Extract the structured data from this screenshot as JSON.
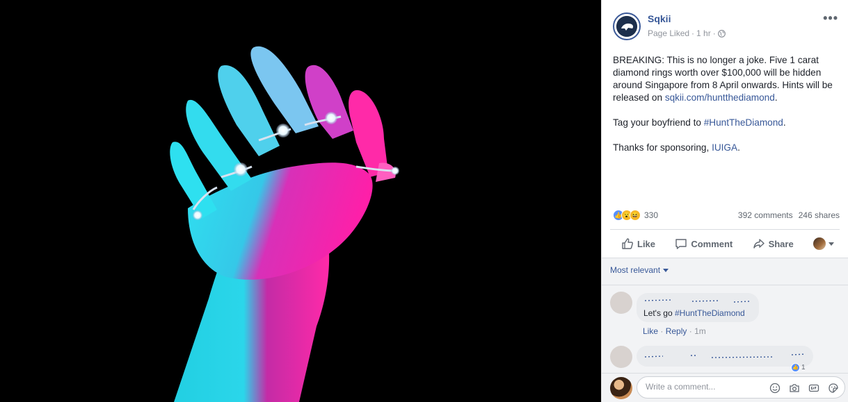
{
  "post": {
    "page_name": "Sqkii",
    "page_liked": "Page Liked",
    "time": "1 hr",
    "more_label": "•••",
    "text_p1_a": "BREAKING: This is no longer a joke. Five 1 carat diamond rings worth over $100,000 will be hidden around Singapore from 8 April onwards. Hints will be released on ",
    "text_p1_link": "sqkii.com/huntthediamond",
    "text_p1_end": ".",
    "text_p2_a": "Tag your boyfriend to ",
    "text_p2_link": "#HuntTheDiamond",
    "text_p2_end": ".",
    "text_p3_a": "Thanks for sponsoring, ",
    "text_p3_link": "IUIGA",
    "text_p3_end": "."
  },
  "stats": {
    "reactions": "330",
    "comments": "392 comments",
    "shares": "246 shares"
  },
  "actions": {
    "like": "Like",
    "comment": "Comment",
    "share": "Share"
  },
  "comments": {
    "sort_label": "Most relevant",
    "items": [
      {
        "text_a": "Let's go ",
        "text_link": "#HuntTheDiamond",
        "like": "Like",
        "reply": "Reply",
        "time": "1m"
      }
    ],
    "reply_reaction_count": "1",
    "input_placeholder": "Write a comment..."
  },
  "colors": {
    "facebook_blue": "#385898",
    "glow_cyan": "#2fe0f0",
    "glow_magenta": "#ff1fa8"
  }
}
